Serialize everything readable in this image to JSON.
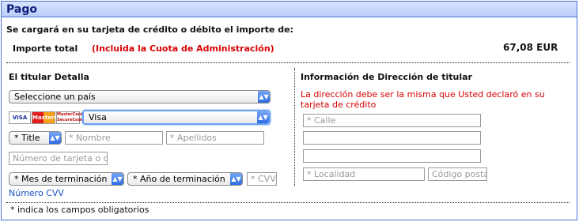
{
  "section": {
    "title": "Pago",
    "charge_notice": "Se cargará en su tarjeta de crédito o débito el importe de:",
    "total_label": "Importe total",
    "admin_fee_note": "(Incluida la Cuota de Administración)",
    "total_amount": "67,08 EUR"
  },
  "holder": {
    "heading": "El titular Detalla",
    "country_select": "Seleccione un país",
    "card_logos": [
      "VISA",
      "MasterCard",
      "MasterCard SecureCode"
    ],
    "card_type_select": "Visa",
    "title_select": "* Title",
    "name_placeholder": "* Nombre",
    "surname_placeholder": "* Apellidos",
    "card_number_placeholder": "Número de tarjeta o c",
    "exp_month_select": "* Mes de terminación",
    "exp_year_select": "* Año de terminación",
    "cvv_placeholder": "* CVV",
    "cvv_link": "Número CVV"
  },
  "address": {
    "heading": "Información de Dirección de titular",
    "warning": "La dirección debe ser la misma que Usted declaró en su tarjeta de crédito",
    "street_placeholder": "* Calle",
    "line2_placeholder": "",
    "line3_placeholder": "",
    "city_placeholder": "* Localidad",
    "postcode_placeholder": "Código posta"
  },
  "footer": {
    "required_note": "* indica los campos obligatorios"
  },
  "colors": {
    "accent_blue": "#4a6fd8",
    "header_bg": "#c8d8ff",
    "warning_red": "#d80000",
    "link_blue": "#1a55c8"
  }
}
